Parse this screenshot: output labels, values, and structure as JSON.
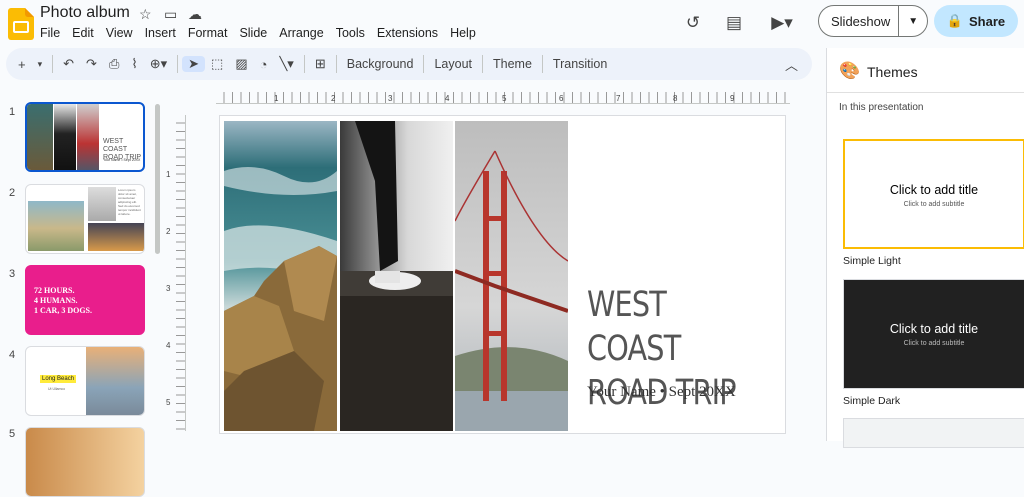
{
  "app": {
    "doc_title": "Photo album",
    "menu": [
      "File",
      "Edit",
      "View",
      "Insert",
      "Format",
      "Slide",
      "Arrange",
      "Tools",
      "Extensions",
      "Help"
    ],
    "slideshow_label": "Slideshow",
    "share_label": "Share",
    "accent": "#fbbc04"
  },
  "toolbar": {
    "text_buttons": [
      "Background",
      "Layout",
      "Theme",
      "Transition"
    ]
  },
  "filmstrip": {
    "slides": [
      {
        "num": "1",
        "title": "WEST COAST ROAD TRIP",
        "sub": "Your Name • Sept 20XX"
      },
      {
        "num": "2",
        "body": "Lorem ipsum dolor sit amet, consectetuer adipiscing elit. Sed do eiusmod tempor incididunt ut labore."
      },
      {
        "num": "3",
        "line1": "72 HOURS.",
        "line2": "4 HUMANS.",
        "line3": "1 CAR, 3 DOGS.",
        "bg": "#e91e8c"
      },
      {
        "num": "4",
        "label": "Long Beach",
        "caption": "Ut Ullamco"
      },
      {
        "num": "5"
      }
    ]
  },
  "slide": {
    "title": "WEST COAST\nROAD TRIP",
    "subtitle": "Your Name • Sept 20XX"
  },
  "ruler": {
    "h_numbers": [
      "1",
      "2",
      "3",
      "4",
      "5",
      "6",
      "7",
      "8",
      "9"
    ],
    "v_numbers": [
      "1",
      "2",
      "3",
      "4",
      "5"
    ]
  },
  "themes": {
    "panel_title": "Themes",
    "section": "In this presentation",
    "cards": [
      {
        "name": "Simple Light",
        "title": "Click to add title",
        "subtitle": "Click to add subtitle",
        "bg": "#ffffff",
        "fg": "#000000"
      },
      {
        "name": "Simple Dark",
        "title": "Click to add title",
        "subtitle": "Click to add subtitle",
        "bg": "#212121",
        "fg": "#ffffff"
      }
    ]
  }
}
